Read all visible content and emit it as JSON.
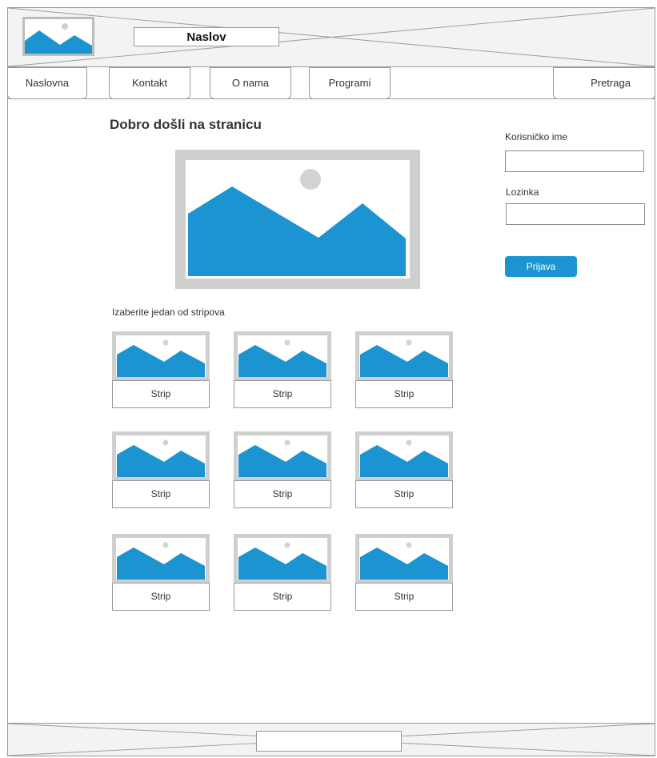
{
  "header": {
    "title": "Naslov"
  },
  "nav": {
    "items": [
      {
        "label": "Naslovna"
      },
      {
        "label": "Kontakt"
      },
      {
        "label": "O nama"
      },
      {
        "label": "Programi"
      }
    ],
    "search_label": "Pretraga"
  },
  "main": {
    "heading": "Dobro došli na stranicu",
    "subheading": "Izaberite jedan od stripova",
    "cards": [
      {
        "label": "Strip"
      },
      {
        "label": "Strip"
      },
      {
        "label": "Strip"
      },
      {
        "label": "Strip"
      },
      {
        "label": "Strip"
      },
      {
        "label": "Strip"
      },
      {
        "label": "Strip"
      },
      {
        "label": "Strip"
      },
      {
        "label": "Strip"
      }
    ]
  },
  "login": {
    "username_label": "Korisničko ime",
    "username_value": "",
    "password_label": "Lozinka",
    "password_value": "",
    "submit_label": "Prijava"
  },
  "colors": {
    "accent": "#1b94d1",
    "border": "#9a9a9a",
    "placeholder_frame": "#cfcfcf"
  },
  "icons": {
    "image_placeholder": "image-icon"
  }
}
